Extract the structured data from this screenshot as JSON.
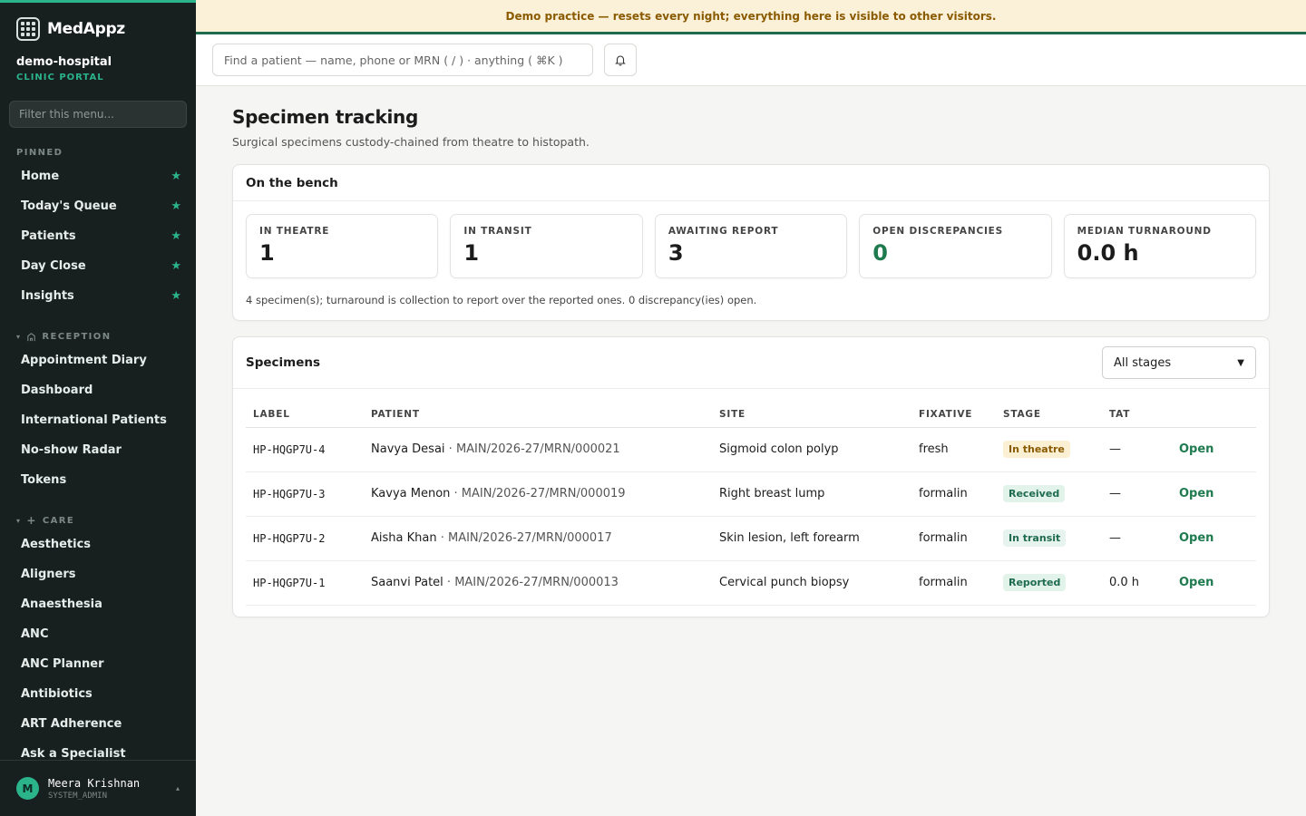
{
  "sidebar": {
    "brand": "MedAppz",
    "org_name": "demo-hospital",
    "org_sub": "CLINIC PORTAL",
    "filter_placeholder": "Filter this menu...",
    "pinned_label": "PINNED",
    "pinned": [
      "Home",
      "Today's Queue",
      "Patients",
      "Day Close",
      "Insights"
    ],
    "reception_label": "RECEPTION",
    "reception": [
      "Appointment Diary",
      "Dashboard",
      "International Patients",
      "No-show Radar",
      "Tokens"
    ],
    "care_label": "CARE",
    "care": [
      "Aesthetics",
      "Aligners",
      "Anaesthesia",
      "ANC",
      "ANC Planner",
      "Antibiotics",
      "ART Adherence",
      "Ask a Specialist"
    ],
    "user": {
      "initial": "M",
      "name": "Meera Krishnan",
      "role": "SYSTEM_ADMIN"
    }
  },
  "banner": "Demo practice — resets every night; everything here is visible to other visitors.",
  "topbar": {
    "search_placeholder": "Find a patient — name, phone or MRN ( / ) · anything ( ⌘K )"
  },
  "page": {
    "title": "Specimen tracking",
    "subtitle": "Surgical specimens custody-chained from theatre to histopath."
  },
  "bench": {
    "title": "On the bench",
    "stats": [
      {
        "label": "IN THEATRE",
        "value": "1"
      },
      {
        "label": "IN TRANSIT",
        "value": "1"
      },
      {
        "label": "AWAITING REPORT",
        "value": "3"
      },
      {
        "label": "OPEN DISCREPANCIES",
        "value": "0"
      },
      {
        "label": "MEDIAN TURNAROUND",
        "value": "0.0 h"
      }
    ],
    "note": "4 specimen(s); turnaround is collection to report over the reported ones. 0 discrepancy(ies) open."
  },
  "specimens": {
    "title": "Specimens",
    "filter_value": "All stages",
    "columns": [
      "LABEL",
      "PATIENT",
      "SITE",
      "FIXATIVE",
      "STAGE",
      "TAT"
    ],
    "rows": [
      {
        "label": "HP-HQGP7U-4",
        "patient": "Navya Desai",
        "mrn": " · MAIN/2026-27/MRN/000021",
        "site": "Sigmoid colon polyp",
        "fixative": "fresh",
        "stage": "In theatre",
        "tat": "—",
        "action": "Open"
      },
      {
        "label": "HP-HQGP7U-3",
        "patient": "Kavya Menon",
        "mrn": " · MAIN/2026-27/MRN/000019",
        "site": "Right breast lump",
        "fixative": "formalin",
        "stage": "Received",
        "tat": "—",
        "action": "Open"
      },
      {
        "label": "HP-HQGP7U-2",
        "patient": "Aisha Khan",
        "mrn": " · MAIN/2026-27/MRN/000017",
        "site": "Skin lesion, left forearm",
        "fixative": "formalin",
        "stage": "In transit",
        "tat": "—",
        "action": "Open"
      },
      {
        "label": "HP-HQGP7U-1",
        "patient": "Saanvi Patel",
        "mrn": " · MAIN/2026-27/MRN/000013",
        "site": "Cervical punch biopsy",
        "fixative": "formalin",
        "stage": "Reported",
        "tat": "0.0 h",
        "action": "Open"
      }
    ]
  }
}
